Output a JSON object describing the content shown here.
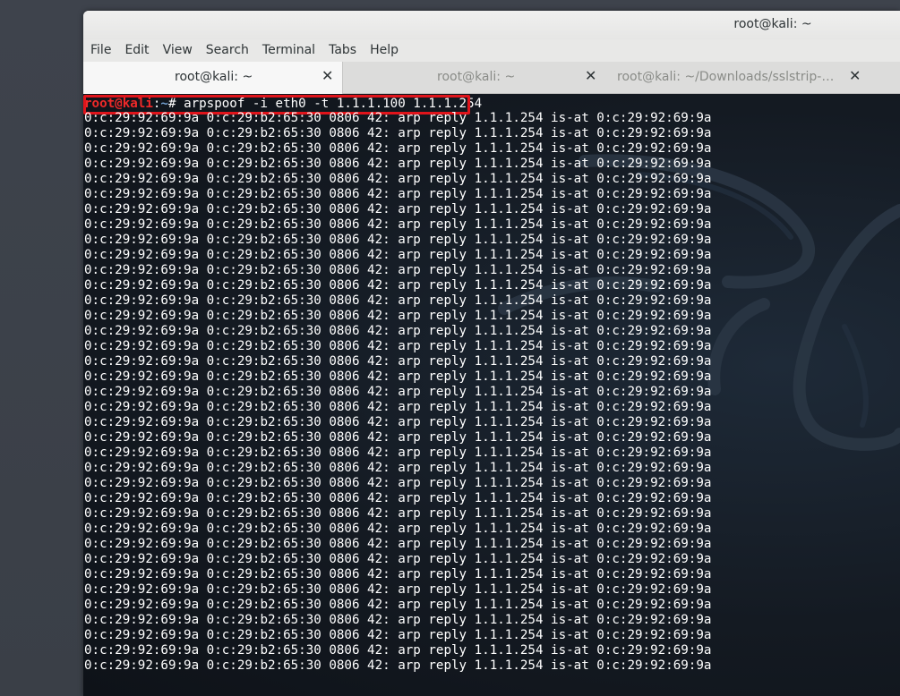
{
  "window": {
    "title": "root@kali: ~"
  },
  "menu": [
    "File",
    "Edit",
    "View",
    "Search",
    "Terminal",
    "Tabs",
    "Help"
  ],
  "tabs": [
    {
      "label": "root@kali: ~",
      "active": true
    },
    {
      "label": "root@kali: ~",
      "active": false
    },
    {
      "label": "root@kali: ~/Downloads/sslstrip-…",
      "active": false
    }
  ],
  "terminal": {
    "prompt_user": "root@kali",
    "prompt_sep": ":",
    "prompt_path": "~",
    "prompt_symbol": "# ",
    "command": "arpspoof -i eth0 -t 1.1.1.100 1.1.1.254",
    "output_line": "0:c:29:92:69:9a 0:c:29:b2:65:30 0806 42: arp reply 1.1.1.254 is-at 0:c:29:92:69:9a",
    "output_line_count": 37
  },
  "colors": {
    "prompt_user": "#ef2929",
    "prompt_path": "#729fcf",
    "highlight": "#e0141b"
  },
  "icons": {
    "tab_close": "close-icon"
  }
}
